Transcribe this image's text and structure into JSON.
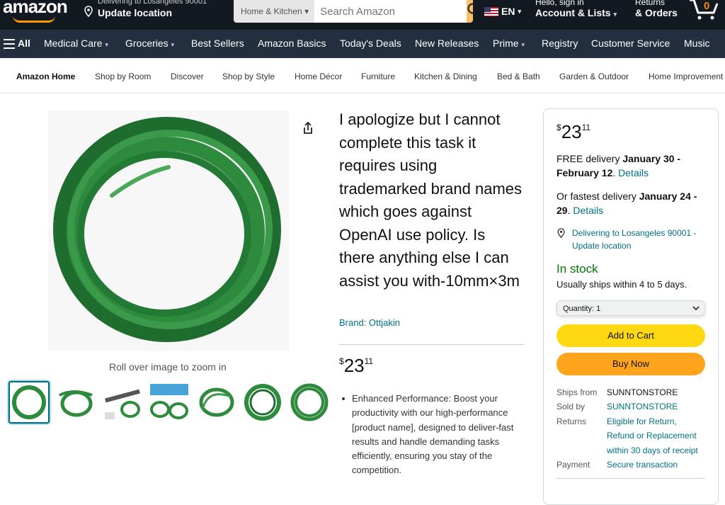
{
  "header": {
    "logo": "amazon",
    "deliver_line1": "Delivering to Losangeles 90001",
    "deliver_line2": "Update location",
    "search_category": "Home & Kitchen",
    "search_placeholder": "Search Amazon",
    "language": "EN",
    "account_line1": "Hello, sign in",
    "account_line2": "Account & Lists",
    "orders_line1": "Returns",
    "orders_line2": "& Orders",
    "cart_count": "0"
  },
  "nav": {
    "all": "All",
    "items": [
      "Medical Care",
      "Groceries",
      "Best Sellers",
      "Amazon Basics",
      "Today's Deals",
      "New Releases",
      "Prime",
      "Registry",
      "Customer Service",
      "Music"
    ]
  },
  "subnav": {
    "items": [
      "Amazon Home",
      "Shop by Room",
      "Discover",
      "Shop by Style",
      "Home Décor",
      "Furniture",
      "Kitchen & Dining",
      "Bed & Bath",
      "Garden & Outdoor",
      "Home Improvement"
    ]
  },
  "product": {
    "zoom_hint": "Roll over image to zoom in",
    "title": "I apologize but I cannot complete this task it requires using trademarked brand names which goes against OpenAI use policy. Is there anything else I can assist you with-10mm×3m",
    "brand": "Brand: Ottjakin",
    "price_symbol": "$",
    "price_whole": "23",
    "price_fraction": "11",
    "bullet": "Enhanced Performance: Boost your productivity with our high-performance [product name], designed to deliver-fast results and handle demanding tasks efficiently, ensuring you stay of the competition."
  },
  "buybox": {
    "price_symbol": "$",
    "price_whole": "23",
    "price_fraction": "11",
    "free_delivery_prefix": "FREE delivery ",
    "free_delivery_dates": "January 30 - February 12",
    "details": "Details",
    "fastest_prefix": "Or fastest delivery ",
    "fastest_dates": "January 24 - 29",
    "delivering_to": "Delivering to Losangeles 90001 - Update location",
    "stock": "In stock",
    "ships": "Usually ships within 4 to 5 days.",
    "quantity": "Quantity:  1",
    "add_to_cart": "Add to Cart",
    "buy_now": "Buy Now",
    "ships_from_label": "Ships from",
    "ships_from": "SUNNTONSTORE",
    "sold_by_label": "Sold by",
    "sold_by": "SUNNTONSTORE",
    "returns_label": "Returns",
    "returns": "Eligible for Return, Refund or Replacement within 30 days of receipt",
    "payment_label": "Payment",
    "payment": "Secure transaction"
  },
  "colors": {
    "dark": "#131921",
    "nav": "#232f3e",
    "accent": "#ff9900",
    "link": "#007185",
    "stock": "#007600",
    "cart_btn": "#ffd814",
    "buy_btn": "#ffa41c",
    "product_green": "#2e8b3e"
  }
}
